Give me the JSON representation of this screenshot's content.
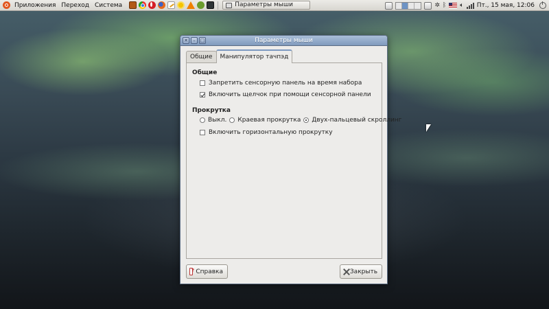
{
  "top_panel": {
    "menu": [
      "Приложения",
      "Переход",
      "Система"
    ],
    "taskbar_window_title": "Параметры мыши",
    "clock": "Пт., 15 мая, 12:06"
  },
  "dialog": {
    "title": "Параметры мыши",
    "tabs": [
      {
        "label": "Общие",
        "active": false
      },
      {
        "label": "Манипулятор тачпэд",
        "active": true
      }
    ],
    "general": {
      "heading": "Общие",
      "disable_while_typing": {
        "label": "Запретить сенсорную панель на время набора",
        "checked": false
      },
      "tap_to_click": {
        "label": "Включить щелчок при помощи сенсорной панели",
        "checked": true
      }
    },
    "scrolling": {
      "heading": "Прокрутка",
      "options": [
        {
          "label": "Выкл.",
          "selected": false
        },
        {
          "label": "Краевая прокрутка",
          "selected": false
        },
        {
          "label": "Двух-пальцевый скроллинг",
          "selected": true
        }
      ],
      "horizontal": {
        "label": "Включить горизонтальную прокрутку",
        "checked": false
      }
    },
    "buttons": {
      "help": "Справка",
      "close": "Закрыть"
    }
  },
  "colors": {
    "titlebar": "#8ea7c8",
    "dialog_bg": "#edecea",
    "panel_bg": "#e2e0db"
  }
}
